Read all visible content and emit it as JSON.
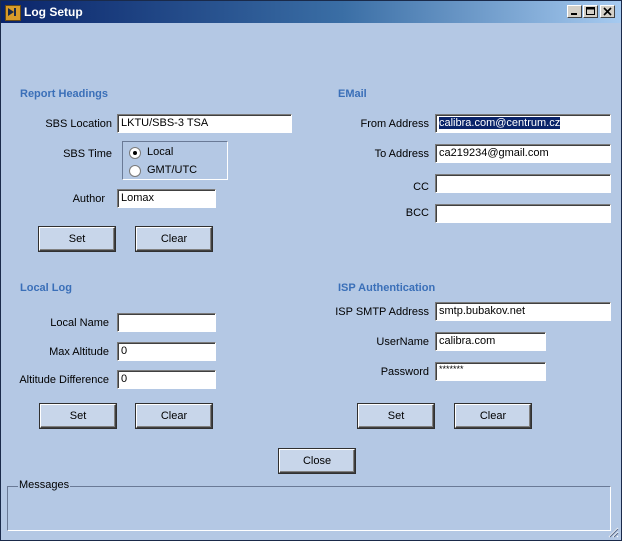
{
  "window": {
    "title": "Log Setup"
  },
  "report_headings": {
    "title": "Report Headings",
    "sbs_location_label": "SBS Location",
    "sbs_location_value": "LKTU/SBS-3 TSA",
    "sbs_time_label": "SBS Time",
    "sbs_time_options": [
      "Local",
      "GMT/UTC"
    ],
    "sbs_time_selected": "Local",
    "author_label": "Author",
    "author_value": "Lomax",
    "set_label": "Set",
    "clear_label": "Clear"
  },
  "email": {
    "title": "EMail",
    "from_label": "From Address",
    "from_value": "calibra.com@centrum.cz",
    "to_label": "To Address",
    "to_value": "ca219234@gmail.com",
    "cc_label": "CC",
    "cc_value": "",
    "bcc_label": "BCC",
    "bcc_value": ""
  },
  "local_log": {
    "title": "Local Log",
    "local_name_label": "Local Name",
    "local_name_value": "",
    "max_altitude_label": "Max Altitude",
    "max_altitude_value": "0",
    "altitude_difference_label": "Altitude Difference",
    "altitude_difference_value": "0",
    "set_label": "Set",
    "clear_label": "Clear"
  },
  "isp": {
    "title": "ISP Authentication",
    "smtp_label": "ISP SMTP Address",
    "smtp_value": "smtp.bubakov.net",
    "username_label": "UserName",
    "username_value": "calibra.com",
    "password_label": "Password",
    "password_value": "*******",
    "set_label": "Set",
    "clear_label": "Clear"
  },
  "close_label": "Close",
  "messages_label": "Messages",
  "colors": {
    "section_heading": "#3a6fb8",
    "background": "#b4c8e4",
    "selection": "#0a246a"
  }
}
